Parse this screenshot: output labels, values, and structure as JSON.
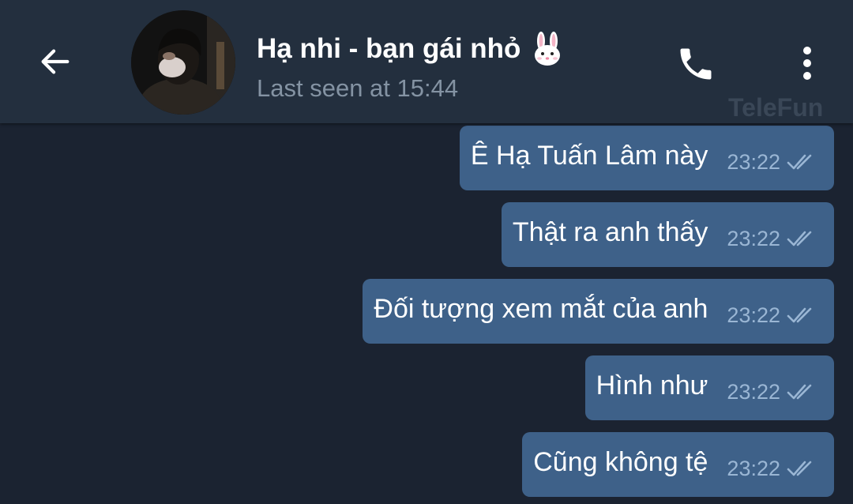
{
  "header": {
    "back_icon": "arrow-left-icon",
    "contact_name": "Hạ nhi - bạn gái nhỏ",
    "name_emoji": "rabbit-face",
    "status": "Last seen at 15:44",
    "call_icon": "phone-icon",
    "menu_icon": "more-vertical-icon"
  },
  "watermark": "TeleFun",
  "messages": [
    {
      "text": "Ê Hạ Tuấn Lâm này",
      "time": "23:22",
      "status_icon": "double-check-icon"
    },
    {
      "text": "Thật ra anh thấy",
      "time": "23:22",
      "status_icon": "double-check-icon"
    },
    {
      "text": "Đối tượng xem mắt của anh",
      "time": "23:22",
      "status_icon": "double-check-icon"
    },
    {
      "text": "Hình như",
      "time": "23:22",
      "status_icon": "double-check-icon"
    },
    {
      "text": "Cũng không tệ",
      "time": "23:22",
      "status_icon": "double-check-icon"
    }
  ],
  "colors": {
    "header_bg": "#232f3e",
    "chat_bg": "#1b2331",
    "bubble_out": "#3e6189",
    "status_text": "#8493a3",
    "time_text": "#9ab6d4"
  }
}
